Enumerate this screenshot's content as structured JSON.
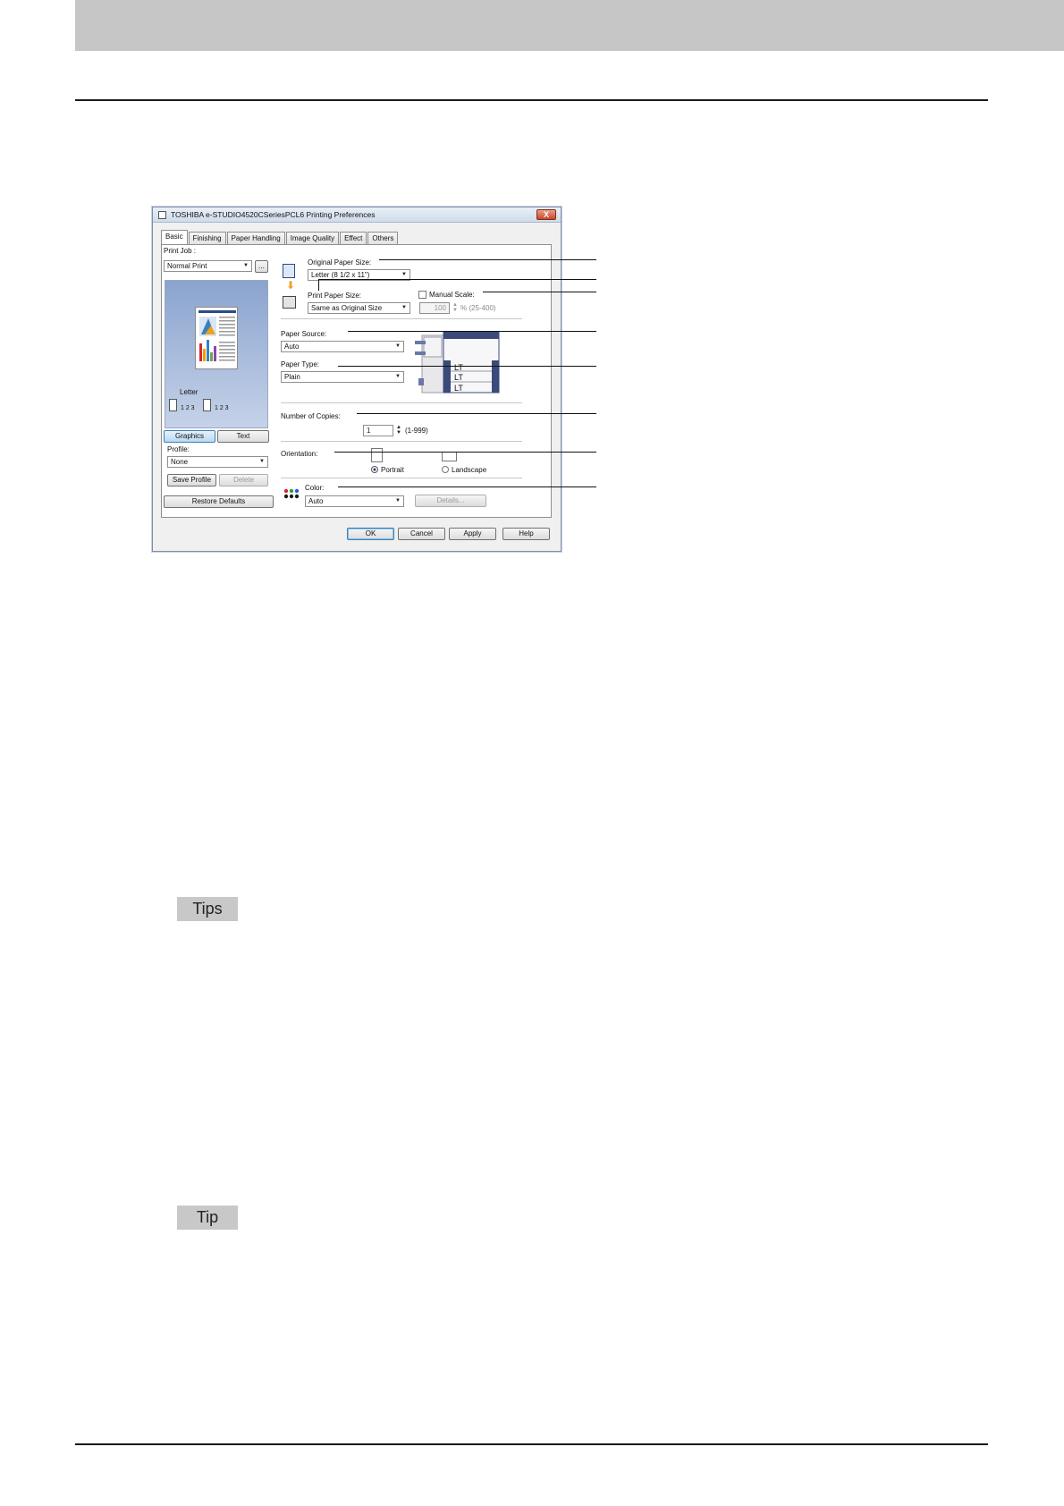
{
  "tags": {
    "tips": "Tips",
    "tip": "Tip"
  },
  "dialog": {
    "title": "TOSHIBA e-STUDIO4520CSeriesPCL6 Printing Preferences",
    "close_label": "X",
    "tabs": [
      "Basic",
      "Finishing",
      "Paper Handling",
      "Image Quality",
      "Effect",
      "Others"
    ],
    "print_job": {
      "label": "Print Job :",
      "value": "Normal Print",
      "more": "..."
    },
    "preview": {
      "paper_label": "Letter",
      "order_a": "1 2 3",
      "order_b": "1 2 3",
      "graphics": "Graphics",
      "text": "Text"
    },
    "profile": {
      "label": "Profile:",
      "value": "None",
      "save": "Save Profile",
      "delete": "Delete"
    },
    "restore": "Restore Defaults",
    "original_paper_size": {
      "label": "Original Paper Size:",
      "value": "Letter (8 1/2 x 11\")"
    },
    "print_paper_size": {
      "label": "Print Paper Size:",
      "value": "Same as Original Size"
    },
    "manual_scale": {
      "label": "Manual Scale:",
      "value": "100",
      "range": "% (25-400)"
    },
    "paper_source": {
      "label": "Paper Source:",
      "value": "Auto"
    },
    "paper_type": {
      "label": "Paper Type:",
      "value": "Plain"
    },
    "trays": [
      "LT",
      "LT",
      "LT"
    ],
    "copies": {
      "label": "Number of Copies:",
      "value": "1",
      "range": "(1-999)"
    },
    "orientation": {
      "label": "Orientation:",
      "portrait": "Portrait",
      "landscape": "Landscape"
    },
    "color": {
      "label": "Color:",
      "value": "Auto",
      "details": "Details..."
    },
    "buttons": {
      "ok": "OK",
      "cancel": "Cancel",
      "apply": "Apply",
      "help": "Help"
    }
  }
}
